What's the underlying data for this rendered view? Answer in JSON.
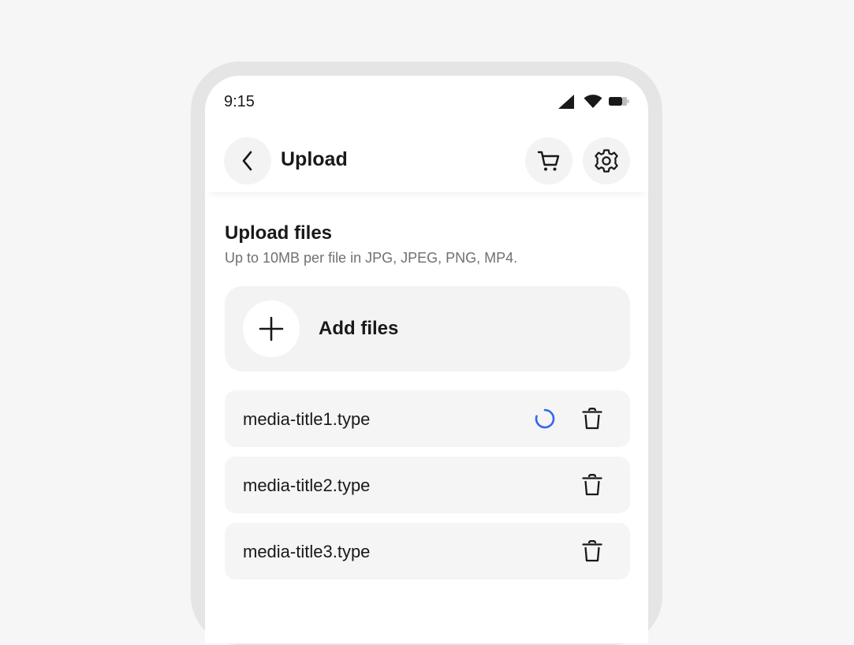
{
  "status_bar": {
    "time": "9:15",
    "icons": [
      "signal-icon",
      "wifi-icon",
      "battery-icon"
    ]
  },
  "app_bar": {
    "title": "Upload",
    "back_icon": "chevron-left-icon",
    "cart_icon": "cart-icon",
    "settings_icon": "gear-icon"
  },
  "upload": {
    "title": "Upload files",
    "subtitle": "Up to 10MB per file in JPG, JPEG, PNG, MP4.",
    "add_label": "Add files",
    "add_icon": "plus-icon"
  },
  "files": [
    {
      "name": "media-title1.type",
      "uploading": true
    },
    {
      "name": "media-title2.type",
      "uploading": false
    },
    {
      "name": "media-title3.type",
      "uploading": false
    }
  ],
  "colors": {
    "background": "#f6f6f6",
    "device_frame": "#e5e5e5",
    "surface": "#ffffff",
    "card": "#f3f3f3",
    "text_primary": "#191919",
    "text_secondary": "#707070",
    "spinner_accent": "#3665f3"
  }
}
